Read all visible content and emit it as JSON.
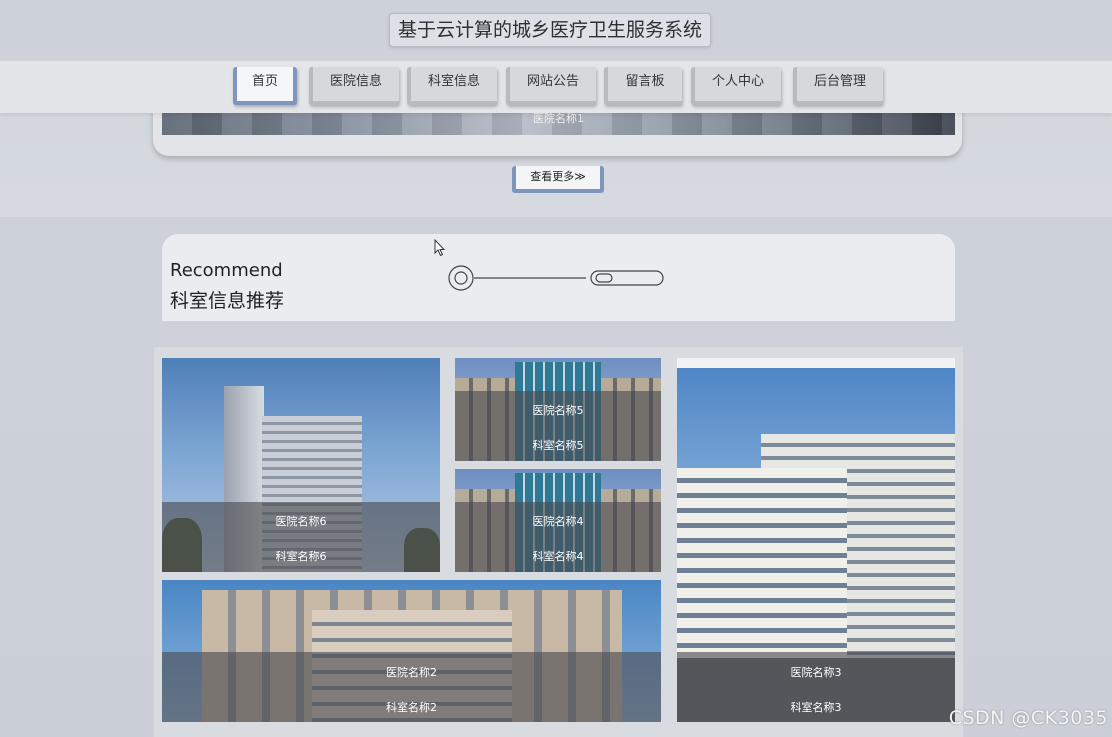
{
  "site": {
    "title": "基于云计算的城乡医疗卫生服务系统"
  },
  "nav": {
    "items": [
      {
        "label": "首页",
        "active": true
      },
      {
        "label": "医院信息",
        "active": false
      },
      {
        "label": "科室信息",
        "active": false
      },
      {
        "label": "网站公告",
        "active": false
      },
      {
        "label": "留言板",
        "active": false
      },
      {
        "label": "个人中心",
        "active": false
      },
      {
        "label": "后台管理",
        "active": false
      }
    ]
  },
  "hospital_section": {
    "visible_item_label": "医院名称1",
    "more_label": "查看更多≫"
  },
  "recommend": {
    "title_en": "Recommend",
    "title_zh": "科室信息推荐",
    "cards": [
      {
        "hospital": "医院名称6",
        "department": "科室名称6"
      },
      {
        "hospital": "医院名称5",
        "department": "科室名称5"
      },
      {
        "hospital": "医院名称4",
        "department": "科室名称4"
      },
      {
        "hospital": "医院名称3",
        "department": "科室名称3"
      },
      {
        "hospital": "医院名称2",
        "department": "科室名称2"
      }
    ]
  },
  "watermark": "CSDN @CK3035",
  "colors": {
    "accent": "#7e96bd",
    "background": "#d4d8df",
    "nav_bg": "#e4e5e8"
  },
  "icons": [
    "mouse-cursor-icon",
    "decorative-circle-icon",
    "decorative-pill-icon"
  ]
}
